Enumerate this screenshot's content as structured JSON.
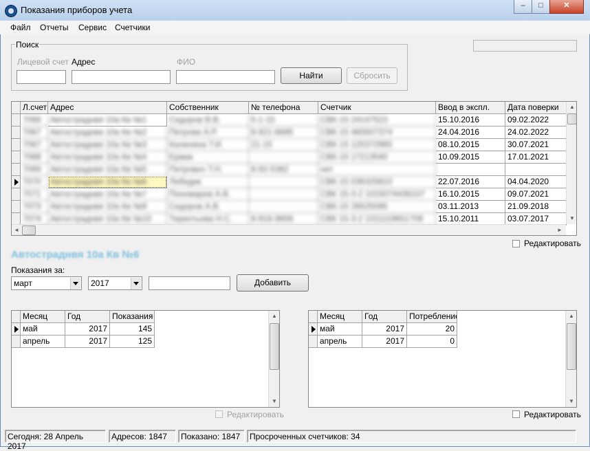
{
  "window": {
    "title": "Показания приборов учета",
    "minimize": "‒",
    "maximize": "□",
    "close": "✕"
  },
  "menu": [
    "Файл",
    "Отчеты",
    "Сервис",
    "Счетчики"
  ],
  "search": {
    "caption": "Поиск",
    "account_label": "Лицевой счет",
    "address_label": "Адрес",
    "fio_label": "ФИО",
    "find_button": "Найти",
    "reset_button": "Сбросить",
    "account_value": "",
    "address_value": "",
    "fio_value": ""
  },
  "main_table": {
    "columns": [
      "Л.счет",
      "Адрес",
      "Собственник",
      "№ телефона",
      "Счетчик",
      "Ввод в экспл.",
      "Дата поверки"
    ],
    "rows": [
      [
        "7066",
        "Автостраднвя 10а Кв №1",
        "Сидоров В.В.",
        "5-1-15",
        "СВК-15 24147523",
        "15.10.2016",
        "09.02.2022"
      ],
      [
        "7067",
        "Автостраднвя 10а Кв №2",
        "Петрова А.Р.",
        "8-921-6695",
        "СВК-15 465507374",
        "24.04.2016",
        "24.02.2022"
      ],
      [
        "7067",
        "Автостраднвя 10а Кв №3",
        "Калинина Т.И.",
        "21-15",
        "СВК-15 125372965",
        "08.10.2015",
        "30.07.2021"
      ],
      [
        "7068",
        "Автостраднвя 10а Кв №4",
        "Ермак",
        "",
        "СВК-15 17213540",
        "10.09.2015",
        "17.01.2021"
      ],
      [
        "7069",
        "Автостраднвя 10а Кв №5",
        "Петрович Т.Н.",
        "8-92-5382",
        "нет",
        "",
        ""
      ],
      [
        "7070",
        "Автостраднвя 10а Кв №6",
        "Лебедик",
        "",
        "СВК-15 036325810",
        "22.07.2016",
        "04.04.2020"
      ],
      [
        "7071",
        "Автостраднвя 10а Кв №7",
        "Пономарев А.В.",
        "",
        "СВК 15-3-2 1015074436107",
        "16.10.2015",
        "09.07.2021"
      ],
      [
        "7073",
        "Автостраднвя 10а Кв №9",
        "Сидоров А.В.",
        "",
        "СВК-15 26525095",
        "03.11.2013",
        "21.09.2018"
      ],
      [
        "7074",
        "Автостраднвя 10а Кв №10",
        "Терентьева Н.С.",
        "8-916-9656",
        "СВК 15-3-2 1011119651709",
        "15.10.2011",
        "03.07.2017"
      ]
    ]
  },
  "edit_main_label": "Редактировать",
  "address_heading": "Автостраднвя 10а Кв №6",
  "readings": {
    "label": "Показания за:",
    "month_value": "март",
    "year_value": "2017",
    "value_input": "",
    "add_button": "Добавить"
  },
  "left_table": {
    "columns": [
      "Месяц",
      "Год",
      "Показания"
    ],
    "rows": [
      [
        "май",
        "2017",
        "145"
      ],
      [
        "апрель",
        "2017",
        "125"
      ]
    ]
  },
  "right_table": {
    "columns": [
      "Месяц",
      "Год",
      "Потребление"
    ],
    "rows": [
      [
        "май",
        "2017",
        "20"
      ],
      [
        "апрель",
        "2017",
        "0"
      ]
    ]
  },
  "edit_left_label": "Редактировать",
  "edit_right_label": "Редактировать",
  "statusbar": {
    "today": "Сегодня: 28 Апрель 2017",
    "addresses": "Адресов: 1847",
    "shown": "Показано: 1847",
    "overdue": "Просроченных счетчиков: 34"
  },
  "icons": {
    "scroll_up": "▲",
    "scroll_down": "▼",
    "scroll_left": "◄",
    "scroll_right": "►"
  }
}
